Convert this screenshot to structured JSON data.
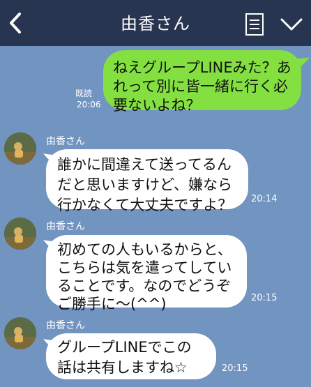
{
  "header": {
    "title": "由香さん",
    "icons": [
      "back-chevron",
      "memo",
      "chevron-down"
    ]
  },
  "colors": {
    "header_bg": "#273550",
    "chat_bg": "#7194c1",
    "outgoing_bubble": "#84e040",
    "incoming_bubble": "#ffffff"
  },
  "messages": [
    {
      "direction": "outgoing",
      "text": "ねえグループLINEみた？あれって別に皆一緒に行く必要ないよね？",
      "read_label": "既読",
      "time": "20:06"
    },
    {
      "direction": "incoming",
      "sender": "由香さん",
      "text": "誰かに間違えて送ってるんだと思いますけど、嫌なら行かなくて大丈夫ですよ？",
      "time": "20:14"
    },
    {
      "direction": "incoming",
      "sender": "由香さん",
      "text": "初めての人もいるからと、こちらは気を遣ってしていることです。なのでどうぞご勝手に〜(^^)",
      "time": "20:15"
    },
    {
      "direction": "incoming",
      "sender": "由香さん",
      "text": "グループLINEでこの話は共有しますね☆",
      "time": "20:15"
    }
  ]
}
